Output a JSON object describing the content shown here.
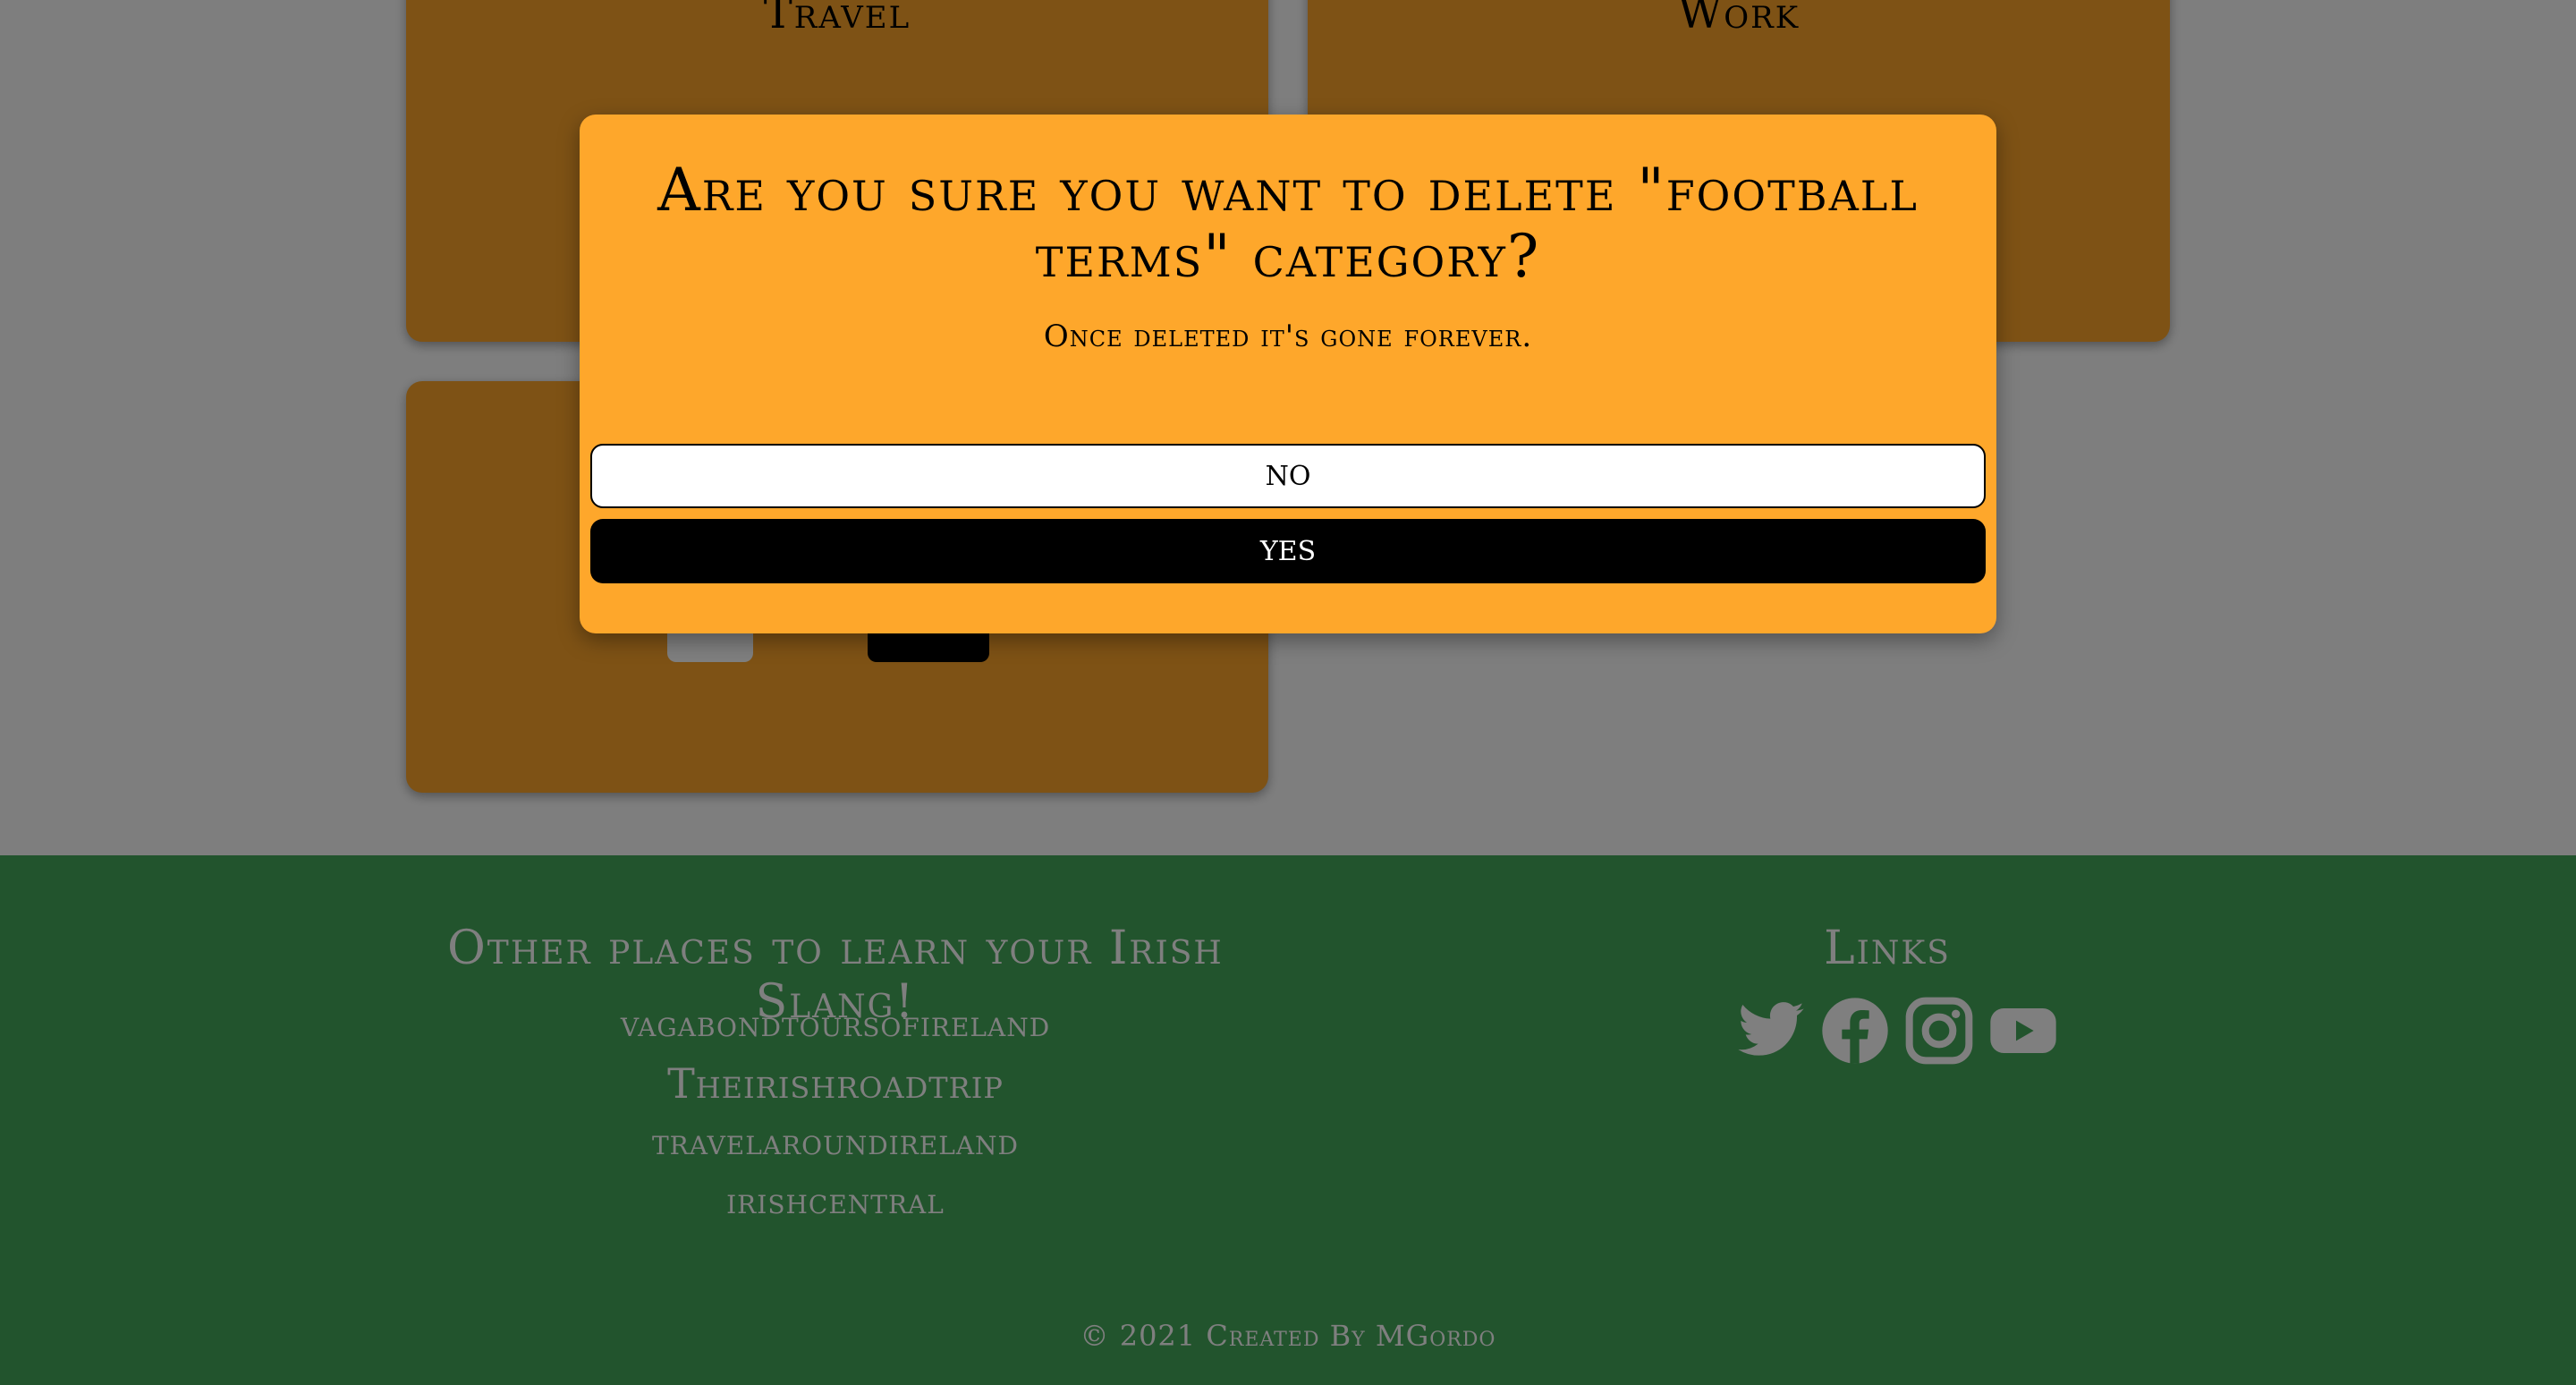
{
  "categories": {
    "travel": {
      "title": "Travel"
    },
    "work": {
      "title": "Work"
    }
  },
  "footer": {
    "other_places_heading": "Other places to learn your Irish Slang!",
    "links": [
      "vagabondtoursofireland",
      "Theirishroadtrip",
      "travelaroundireland",
      "irishcentral"
    ],
    "links_heading": "Links",
    "social_icons": [
      "twitter-icon",
      "facebook-icon",
      "instagram-icon",
      "youtube-icon"
    ],
    "copyright": "© 2021 Created By MGordo"
  },
  "modal": {
    "title": "Are you sure you want to delete \"football terms\" category?",
    "subtitle": "Once deleted it's gone forever.",
    "no_label": "NO",
    "yes_label": "YES"
  },
  "colors": {
    "card": "#fda42b",
    "footer": "#44a85a",
    "modal": "#fea72b"
  }
}
